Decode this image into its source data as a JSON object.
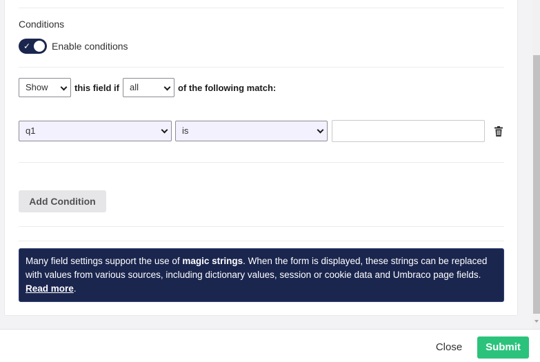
{
  "conditions": {
    "title": "Conditions",
    "toggle": {
      "label": "Enable conditions",
      "checked": true,
      "check_glyph": "✓"
    },
    "rule": {
      "action": "Show",
      "middle_text": "this field if",
      "match": "all",
      "suffix_text": "of the following match:"
    },
    "condition_row": {
      "field": "q1",
      "operator": "is",
      "value": ""
    },
    "add_label": "Add Condition"
  },
  "info": {
    "text_before": "Many field settings support the use of ",
    "magic": "magic strings",
    "text_after": ". When the form is displayed, these strings can be replaced with values from various sources, including dictionary values, session or cookie data and Umbraco page fields. ",
    "read_more": "Read more",
    "end": "."
  },
  "footer": {
    "close_label": "Close",
    "submit_label": "Submit"
  },
  "colors": {
    "primary": "#1b264f",
    "submit": "#2bc37c",
    "tinted_select": "#f4f1ff"
  },
  "icons": {
    "toggle_check": "check-icon",
    "delete": "trash-icon",
    "dropdown": "chevron-down-icon"
  }
}
